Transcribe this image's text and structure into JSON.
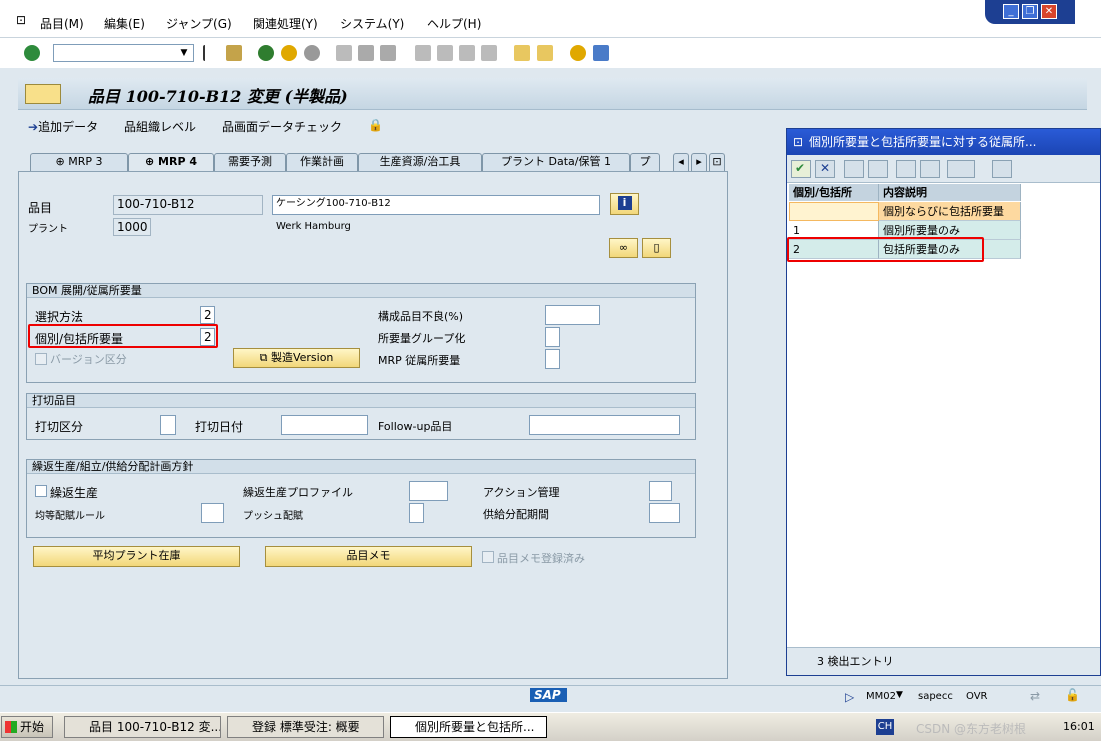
{
  "menu": [
    "品目(M)",
    "編集(E)",
    "ジャンプ(G)",
    "関連処理(Y)",
    "システム(Y)",
    "ヘルプ(H)"
  ],
  "title": "品目 100-710-B12 変更 (半製品)",
  "app_toolbar": [
    "追加データ",
    "組織レベル",
    "画面データチェック"
  ],
  "tabs": [
    "MRP 3",
    "MRP 4",
    "需要予測",
    "作業計画",
    "生産資源/治工具",
    "プラント Data/保管 1",
    "プ"
  ],
  "header": {
    "material_label": "品目",
    "material_value": "100-710-B12",
    "material_desc": "ケーシング100-710-B12",
    "plant_label": "プラント",
    "plant_value": "1000",
    "plant_desc": "Werk Hamburg"
  },
  "bom": {
    "title": "BOM 展開/従属所要量",
    "selection_label": "選択方法",
    "selection_value": "2",
    "indiv_label": "個別/包括所要量",
    "indiv_value": "2",
    "version_label": "バージョン区分",
    "version_button": "製造Version",
    "scrap_label": "構成品目不良(%)",
    "group_label": "所要量グループ化",
    "mrp_dep_label": "MRP 従属所要量"
  },
  "discontinued": {
    "title": "打切品目",
    "ind_label": "打切区分",
    "date_label": "打切日付",
    "followup_label": "Follow-up品目"
  },
  "repetitive": {
    "title": "繰返生産/組立/供給分配計画方針",
    "rep_label": "繰返生産",
    "profile_label": "繰返生産プロファイル",
    "action_label": "アクション管理",
    "fair_label": "均等配賦ルール",
    "push_label": "プッシュ配賦",
    "period_label": "供給分配期間"
  },
  "buttons": {
    "avg_plant": "平均プラント在庫",
    "memo": "品目メモ",
    "memo_done": "品目メモ登録済み"
  },
  "popup": {
    "title": "個別所要量と包括所要量に対する従属所...",
    "col1": "個別/包括所",
    "col2": "内容説明",
    "rows": [
      {
        "key": "",
        "desc": "個別ならびに包括所要量"
      },
      {
        "key": "1",
        "desc": "個別所要量のみ"
      },
      {
        "key": "2",
        "desc": "包括所要量のみ"
      }
    ],
    "status": "3 検出エントリ"
  },
  "statusbar": {
    "logo": "SAP",
    "tcode": "MM02",
    "server": "sapecc",
    "mode": "OVR"
  },
  "taskbar": {
    "start": "开始",
    "items": [
      "品目 100-710-B12 変...",
      "登録 標準受注: 概要",
      "個別所要量と包括所..."
    ],
    "lang": "CH",
    "clock": "16:01",
    "watermark": "CSDN @东方老树根"
  }
}
